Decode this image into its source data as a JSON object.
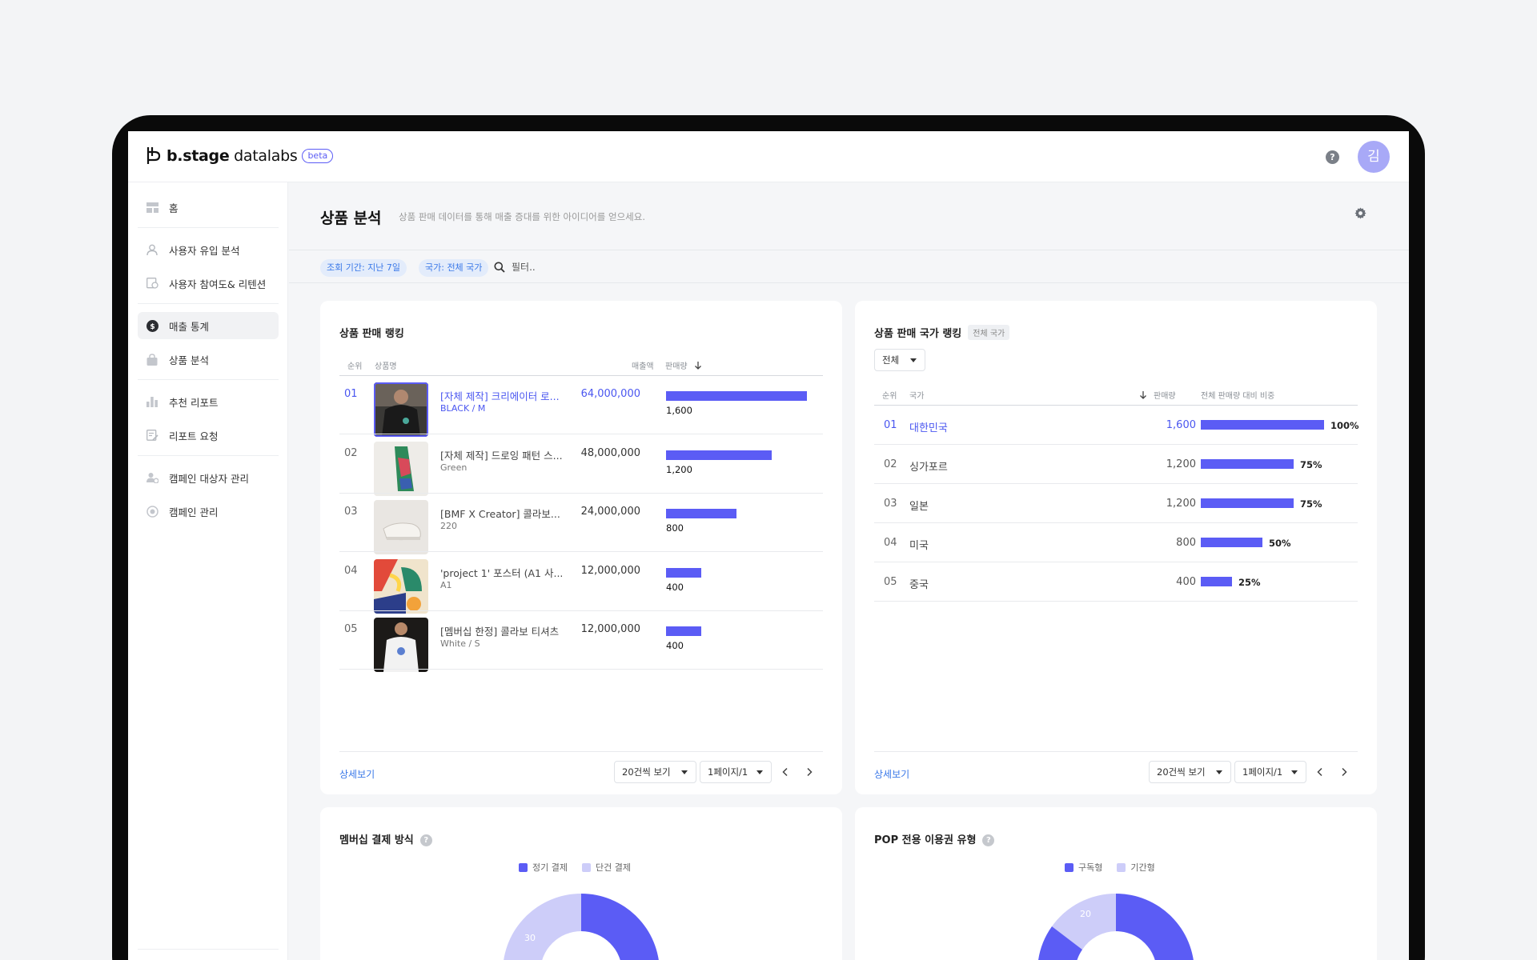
{
  "app": {
    "logo_word": "b.stage",
    "logo_sub": "datalabs",
    "badge": "beta",
    "help": "?",
    "avatar_initial": "김"
  },
  "sidebar": {
    "items": [
      {
        "label": "홈",
        "icon": "layout-icon"
      },
      {
        "label": "사용자 유입 분석",
        "icon": "user-icon"
      },
      {
        "label": "사용자 참여도& 리텐션",
        "icon": "engagement-icon"
      },
      {
        "label": "매출 통계",
        "icon": "dollar-icon"
      },
      {
        "label": "상품 분석",
        "icon": "bag-icon"
      },
      {
        "label": "추천 리포트",
        "icon": "bar-chart-icon"
      },
      {
        "label": "리포트 요청",
        "icon": "edit-doc-icon"
      },
      {
        "label": "캠페인 대상자 관리",
        "icon": "user-gear-icon"
      },
      {
        "label": "캠페인 관리",
        "icon": "target-icon"
      }
    ],
    "active_index": 3
  },
  "page": {
    "title": "상품 분석",
    "description": "상품 판매 데이터를 통해 매출 증대를 위한 아이디어를 얻으세요."
  },
  "filters": {
    "period": "조회 기간: 지난 7일",
    "country": "국가: 전체 국가",
    "search_placeholder": "필터.."
  },
  "product_ranking": {
    "title": "상품 판매 랭킹",
    "headers": {
      "rank": "순위",
      "name": "상품명",
      "revenue": "매출액",
      "qty": "판매량"
    },
    "rows": [
      {
        "rank": "01",
        "name": "[자체 제작] 크리에이터 로...",
        "option": "BLACK / M",
        "revenue": "64,000,000",
        "qty": "1,600",
        "qty_value": 1600
      },
      {
        "rank": "02",
        "name": "[자체 제작] 드로잉 패턴 스...",
        "option": "Green",
        "revenue": "48,000,000",
        "qty": "1,200",
        "qty_value": 1200
      },
      {
        "rank": "03",
        "name": "[BMF X Creator] 콜라보...",
        "option": "220",
        "revenue": "24,000,000",
        "qty": "800",
        "qty_value": 800
      },
      {
        "rank": "04",
        "name": "'project 1' 포스터 (A1 사...",
        "option": "A1",
        "revenue": "12,000,000",
        "qty": "400",
        "qty_value": 400
      },
      {
        "rank": "05",
        "name": "[멤버십 한정] 콜라보 티셔츠",
        "option": "White / S",
        "revenue": "12,000,000",
        "qty": "400",
        "qty_value": 400
      }
    ],
    "more": "상세보기",
    "page_size": "20건씩 보기",
    "page": "1페이지/1"
  },
  "country_ranking": {
    "title": "상품 판매 국가 랭킹",
    "scope": "전체 국가",
    "dropdown": "전체",
    "headers": {
      "rank": "순위",
      "country": "국가",
      "qty": "판매량",
      "share": "전체 판매량 대비 비중"
    },
    "rows": [
      {
        "rank": "01",
        "country": "대한민국",
        "qty": "1,600",
        "share": "100%",
        "share_value": 100
      },
      {
        "rank": "02",
        "country": "싱가포르",
        "qty": "1,200",
        "share": "75%",
        "share_value": 75
      },
      {
        "rank": "03",
        "country": "일본",
        "qty": "1,200",
        "share": "75%",
        "share_value": 75
      },
      {
        "rank": "04",
        "country": "미국",
        "qty": "800",
        "share": "50%",
        "share_value": 50
      },
      {
        "rank": "05",
        "country": "중국",
        "qty": "400",
        "share": "25%",
        "share_value": 25
      }
    ],
    "more": "상세보기",
    "page_size": "20건씩 보기",
    "page": "1페이지/1"
  },
  "membership_payment": {
    "title": "멤버십 결제 방식",
    "legend": [
      "정기 결제",
      "단건 결제"
    ],
    "labels": [
      "30"
    ],
    "colors": [
      "#5b5cf5",
      "#cdcdf9"
    ]
  },
  "pop_pass": {
    "title": "POP 전용 이용권 유형",
    "legend": [
      "구독형",
      "기간형"
    ],
    "labels": [
      "20"
    ],
    "colors": [
      "#5b5cf5",
      "#cdcdf9"
    ]
  }
}
